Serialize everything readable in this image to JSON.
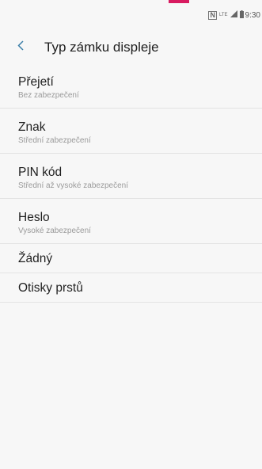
{
  "status_bar": {
    "icons": [
      "nfc-icon",
      "lte-icon",
      "signal-icon",
      "battery-icon"
    ],
    "nfc_glyph": "N",
    "lte_glyph": "LTE",
    "time": "9:30"
  },
  "header": {
    "back_icon": "chevron-left-icon",
    "title": "Typ zámku displeje"
  },
  "options": [
    {
      "title": "Přejetí",
      "subtitle": "Bez zabezpečení"
    },
    {
      "title": "Znak",
      "subtitle": "Střední zabezpečení"
    },
    {
      "title": "PIN kód",
      "subtitle": "Střední až vysoké zabezpečení"
    },
    {
      "title": "Heslo",
      "subtitle": "Vysoké zabezpečení"
    },
    {
      "title": "Žádný"
    },
    {
      "title": "Otisky prstů"
    }
  ],
  "colors": {
    "accent": "#3b7fa8",
    "top_indicator": "#d81b60",
    "background": "#f7f7f7"
  }
}
